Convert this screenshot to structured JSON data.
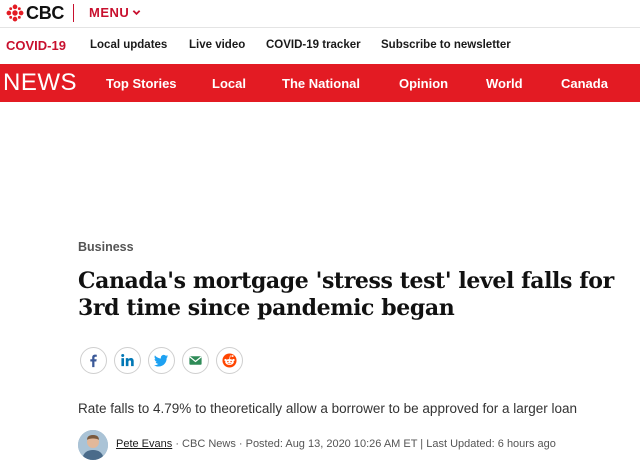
{
  "brand": {
    "logo_text": "CBC",
    "menu_label": "MENU"
  },
  "covid_strip": {
    "label": "COVID-19",
    "links": [
      "Local updates",
      "Live video",
      "COVID-19 tracker",
      "Subscribe to newsletter"
    ]
  },
  "news_nav": {
    "brand": "NEWS",
    "items": [
      "Top Stories",
      "Local",
      "The National",
      "Opinion",
      "World",
      "Canada"
    ]
  },
  "article": {
    "category": "Business",
    "headline": "Canada's mortgage 'stress test' level falls for 3rd time since pandemic began",
    "deck": "Rate falls to 4.79% to theoretically allow a borrower to be approved for a larger loan",
    "author": "Pete Evans",
    "byline_rest": " · CBC News · Posted: Aug 13, 2020 10:26 AM ET | Last Updated: 6 hours ago"
  },
  "share_icons": [
    "facebook-icon",
    "linkedin-icon",
    "twitter-icon",
    "email-icon",
    "reddit-icon"
  ],
  "colors": {
    "brand_red": "#e31b23",
    "accent_red": "#c8102e"
  }
}
